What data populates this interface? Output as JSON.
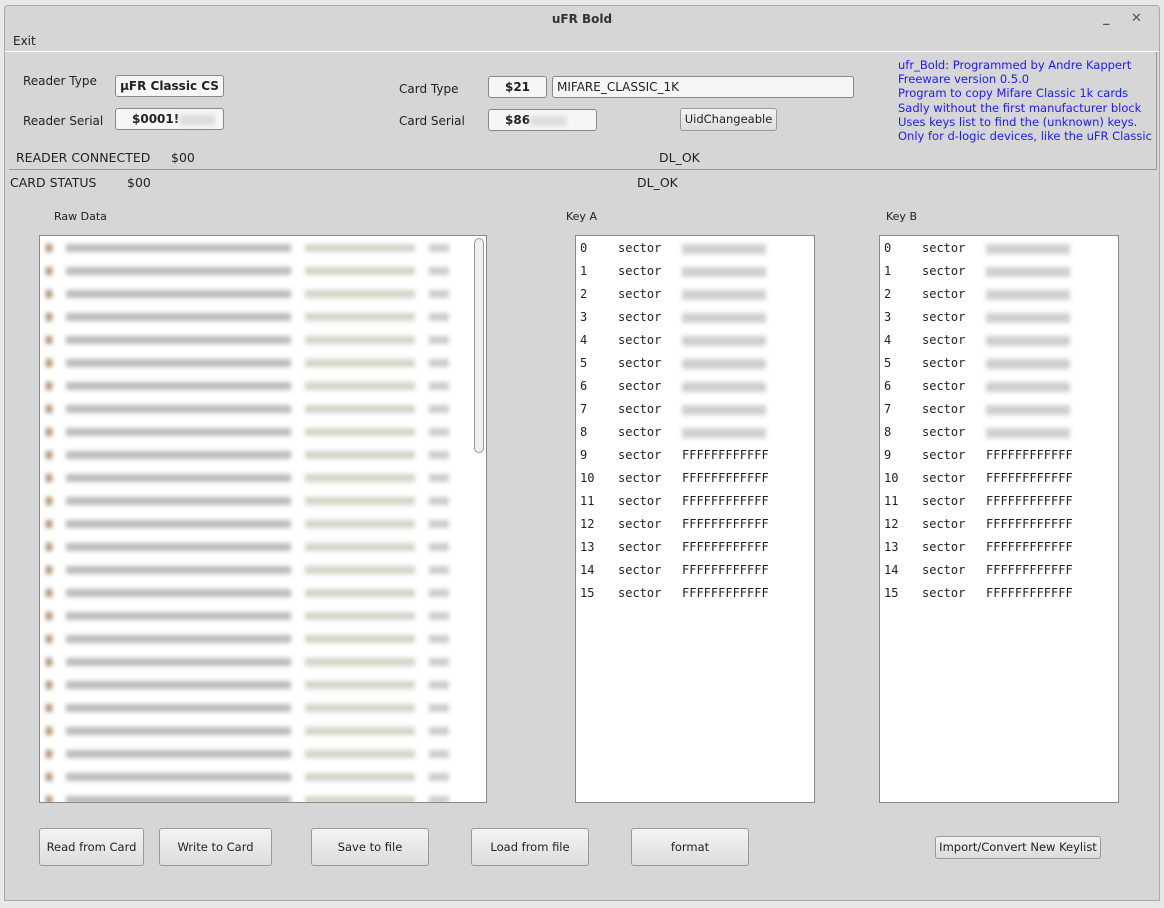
{
  "window": {
    "title": "uFR Bold",
    "minimize": "_",
    "close": "✕"
  },
  "menu": {
    "exit": "Exit"
  },
  "reader": {
    "type_label": "Reader Type",
    "type_value": "µFR Classic CS",
    "serial_label": "Reader Serial",
    "serial_value": "$0001!"
  },
  "card": {
    "type_label": "Card Type",
    "type_code": "$21",
    "type_name": "MIFARE_CLASSIC_1K",
    "serial_label": "Card Serial",
    "serial_value": "$86",
    "uid_button": "UidChangeable"
  },
  "info": [
    "ufr_Bold: Programmed by Andre Kappert",
    "Freeware version 0.5.0",
    "Program to copy Mifare Classic 1k cards",
    "Sadly without the first manufacturer block",
    "Uses keys list to find the (unknown) keys.",
    "Only for d-logic devices, like the uFR Classic"
  ],
  "status": {
    "reader_label": "READER CONNECTED",
    "reader_code": "$00",
    "reader_msg": "DL_OK",
    "card_label": "CARD STATUS",
    "card_code": "$00",
    "card_msg": "DL_OK"
  },
  "panels": {
    "raw": "Raw Data",
    "key_a": "Key A",
    "key_b": "Key B"
  },
  "sector_word": "sector",
  "key_a": [
    "",
    "",
    "",
    "",
    "",
    "",
    "",
    "",
    "",
    "FFFFFFFFFFFF",
    "FFFFFFFFFFFF",
    "FFFFFFFFFFFF",
    "FFFFFFFFFFFF",
    "FFFFFFFFFFFF",
    "FFFFFFFFFFFF",
    "FFFFFFFFFFFF"
  ],
  "key_b": [
    "",
    "",
    "",
    "",
    "",
    "",
    "",
    "",
    "",
    "FFFFFFFFFFFF",
    "FFFFFFFFFFFF",
    "FFFFFFFFFFFF",
    "FFFFFFFFFFFF",
    "FFFFFFFFFFFF",
    "FFFFFFFFFFFF",
    "FFFFFFFFFFFF"
  ],
  "buttons": {
    "read": "Read from Card",
    "write": "Write to Card",
    "save": "Save to file",
    "load": "Load from file",
    "format": "format",
    "import": "Import/Convert New Keylist"
  }
}
